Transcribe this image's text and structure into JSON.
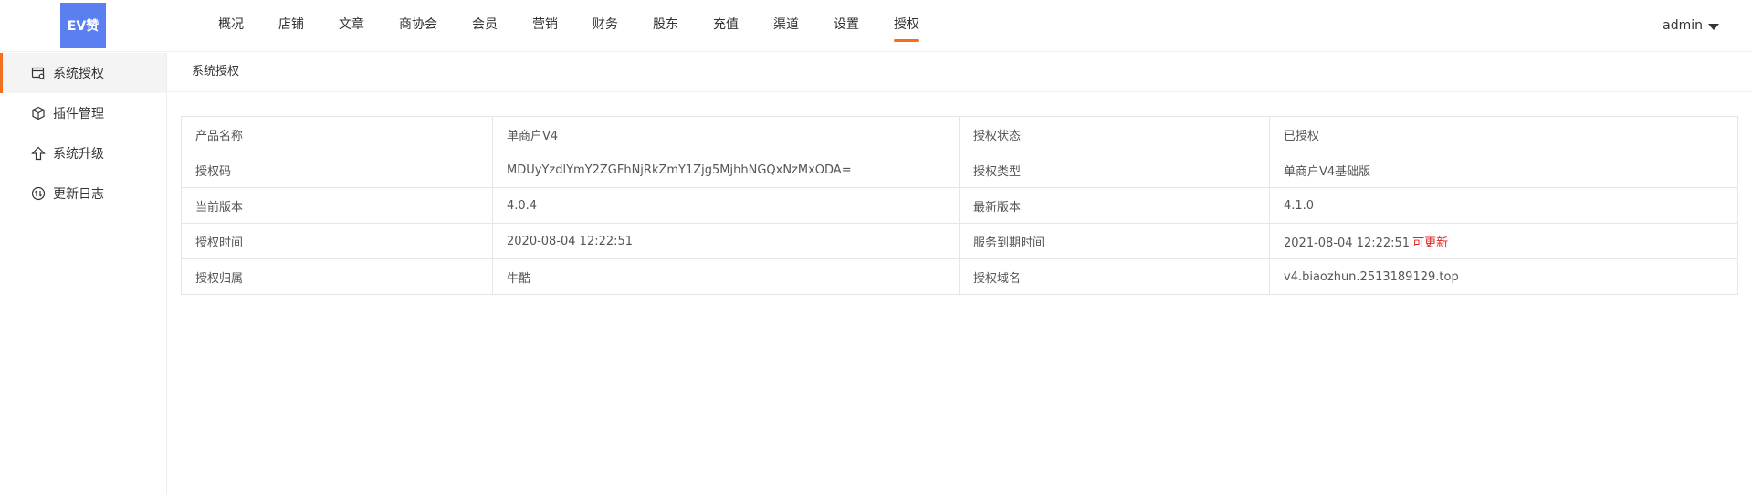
{
  "header": {
    "logo_text": "EV赞",
    "nav": [
      "概况",
      "店铺",
      "文章",
      "商协会",
      "会员",
      "营销",
      "财务",
      "股东",
      "充值",
      "渠道",
      "设置",
      "授权"
    ],
    "active_nav": "授权",
    "user": "admin"
  },
  "sidebar": {
    "items": [
      {
        "label": "系统授权",
        "icon": "license-icon"
      },
      {
        "label": "插件管理",
        "icon": "plugin-cube-icon"
      },
      {
        "label": "系统升级",
        "icon": "upgrade-arrow-icon"
      },
      {
        "label": "更新日志",
        "icon": "update-log-icon"
      }
    ],
    "active": "系统授权"
  },
  "breadcrumb": "系统授权",
  "info": {
    "rows": [
      {
        "l1": "产品名称",
        "v1": "单商户V4",
        "l2": "授权状态",
        "v2": "已授权"
      },
      {
        "l1": "授权码",
        "v1": "MDUyYzdlYmY2ZGFhNjRkZmY1Zjg5MjhhNGQxNzMxODA=",
        "l2": "授权类型",
        "v2": "单商户V4基础版"
      },
      {
        "l1": "当前版本",
        "v1": "4.0.4",
        "l2": "最新版本",
        "v2": "4.1.0"
      },
      {
        "l1": "授权时间",
        "v1": "2020-08-04 12:22:51",
        "l2": "服务到期时间",
        "v2": "2021-08-04 12:22:51"
      },
      {
        "l1": "授权归属",
        "v1": "牛酷",
        "l2": "授权域名",
        "v2": "v4.biaozhun.2513189129.top"
      }
    ],
    "update_link": "可更新"
  },
  "colors": {
    "accent": "#f26f21",
    "logo_bg": "#5b7ff0",
    "link_red": "#e02020"
  }
}
